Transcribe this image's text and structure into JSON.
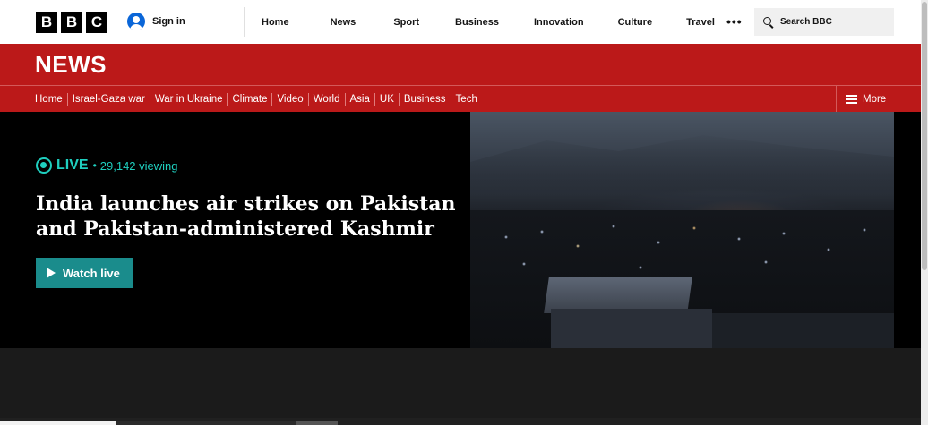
{
  "header": {
    "logo_letters": [
      "B",
      "B",
      "C"
    ],
    "signin_label": "Sign in",
    "nav": [
      "Home",
      "News",
      "Sport",
      "Business",
      "Innovation",
      "Culture",
      "Travel"
    ],
    "more_label": "•••",
    "search_placeholder": "Search BBC"
  },
  "news_banner": {
    "title": "NEWS"
  },
  "sections": {
    "items": [
      "Home",
      "Israel-Gaza war",
      "War in Ukraine",
      "Climate",
      "Video",
      "World",
      "Asia",
      "UK",
      "Business",
      "Tech"
    ],
    "more_label": "More"
  },
  "hero": {
    "live_label": "LIVE",
    "separator": "•",
    "viewers": "29,142 viewing",
    "headline": "India launches air strikes on Pakistan and Pakistan-administered Kashmir",
    "button_label": "Watch live"
  },
  "colors": {
    "brand_red": "#bb1919",
    "live_teal": "#1fcfbf",
    "button_teal": "#1a8c8c"
  }
}
